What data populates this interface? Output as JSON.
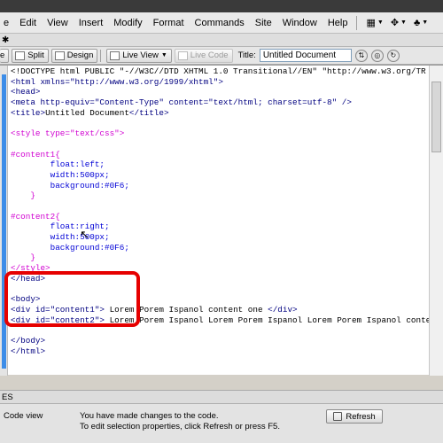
{
  "menu": {
    "items": [
      "e",
      "Edit",
      "View",
      "Insert",
      "Modify",
      "Format",
      "Commands",
      "Site",
      "Window",
      "Help"
    ]
  },
  "toolbar": {
    "tab_close": "✱",
    "split_label": "Split",
    "design_label": "Design",
    "live_view_label": "Live View",
    "live_code_label": "Live Code",
    "title_label": "Title:",
    "title_value": "Untitled Document"
  },
  "code_lines": [
    {
      "segments": [
        {
          "text": "<!DOCTYPE html PUBLIC \"-//W3C//DTD XHTML 1.0 Transitional//EN\" \"http://www.w3.org/TR",
          "cls": ""
        }
      ]
    },
    {
      "segments": [
        {
          "text": "<html xmlns=\"http://www.w3.org/1999/xhtml\">",
          "cls": "c-navy"
        }
      ]
    },
    {
      "segments": [
        {
          "text": "<head>",
          "cls": "c-navy"
        }
      ]
    },
    {
      "segments": [
        {
          "text": "<meta http-equiv=\"Content-Type\" content=\"text/html; charset=utf-8\" />",
          "cls": "c-navy"
        }
      ]
    },
    {
      "segments": [
        {
          "text": "<title>",
          "cls": "c-navy"
        },
        {
          "text": "Untitled Document",
          "cls": ""
        },
        {
          "text": "</title>",
          "cls": "c-navy"
        }
      ]
    },
    {
      "segments": [
        {
          "text": "",
          "cls": ""
        }
      ]
    },
    {
      "segments": [
        {
          "text": "<style type=\"text/css\">",
          "cls": "c-pink"
        }
      ]
    },
    {
      "segments": [
        {
          "text": "",
          "cls": ""
        }
      ]
    },
    {
      "segments": [
        {
          "text": "#content1{",
          "cls": "c-pink"
        }
      ]
    },
    {
      "segments": [
        {
          "text": "        float",
          "cls": "c-blue"
        },
        {
          "text": ":left;",
          "cls": "c-blue"
        }
      ]
    },
    {
      "segments": [
        {
          "text": "        width",
          "cls": "c-blue"
        },
        {
          "text": ":500px;",
          "cls": "c-blue"
        }
      ]
    },
    {
      "segments": [
        {
          "text": "        background",
          "cls": "c-blue"
        },
        {
          "text": ":#0F6;",
          "cls": "c-blue"
        }
      ]
    },
    {
      "segments": [
        {
          "text": "    }",
          "cls": "c-pink"
        }
      ]
    },
    {
      "segments": [
        {
          "text": "",
          "cls": ""
        }
      ]
    },
    {
      "segments": [
        {
          "text": "#content2{",
          "cls": "c-pink"
        }
      ]
    },
    {
      "segments": [
        {
          "text": "        float",
          "cls": "c-blue"
        },
        {
          "text": ":right;",
          "cls": "c-blue"
        }
      ]
    },
    {
      "segments": [
        {
          "text": "        width",
          "cls": "c-blue"
        },
        {
          "text": ":500px;",
          "cls": "c-blue"
        }
      ]
    },
    {
      "segments": [
        {
          "text": "        background",
          "cls": "c-blue"
        },
        {
          "text": ":#0F6;",
          "cls": "c-blue"
        }
      ]
    },
    {
      "segments": [
        {
          "text": "    }",
          "cls": "c-pink"
        }
      ]
    },
    {
      "segments": [
        {
          "text": "</style>",
          "cls": "c-pink"
        }
      ]
    },
    {
      "segments": [
        {
          "text": "</head>",
          "cls": "c-navy"
        }
      ]
    },
    {
      "segments": [
        {
          "text": "",
          "cls": ""
        }
      ]
    },
    {
      "segments": [
        {
          "text": "<body>",
          "cls": "c-navy"
        }
      ]
    },
    {
      "segments": [
        {
          "text": "<div id=\"content1\">",
          "cls": "c-navy"
        },
        {
          "text": " Lorem Porem Ispanol content one ",
          "cls": ""
        },
        {
          "text": "</div>",
          "cls": "c-navy"
        }
      ]
    },
    {
      "segments": [
        {
          "text": "<div id=\"content2\">",
          "cls": "c-navy"
        },
        {
          "text": " Lorem Porem Ispanol Lorem Porem Ispanol Lorem Porem Ispanol conte",
          "cls": ""
        }
      ]
    },
    {
      "segments": [
        {
          "text": "",
          "cls": ""
        }
      ]
    },
    {
      "segments": [
        {
          "text": "</body>",
          "cls": "c-navy"
        }
      ]
    },
    {
      "segments": [
        {
          "text": "</html>",
          "cls": "c-navy"
        }
      ]
    }
  ],
  "colors": {
    "highlight": "#e60000",
    "gutter_bar": "#3d8de8"
  },
  "properties": {
    "header": "ES",
    "mode": "Code view",
    "message_line1": "You have made changes to the code.",
    "message_line2": "To edit selection properties, click Refresh or press F5.",
    "refresh_label": "Refresh"
  }
}
